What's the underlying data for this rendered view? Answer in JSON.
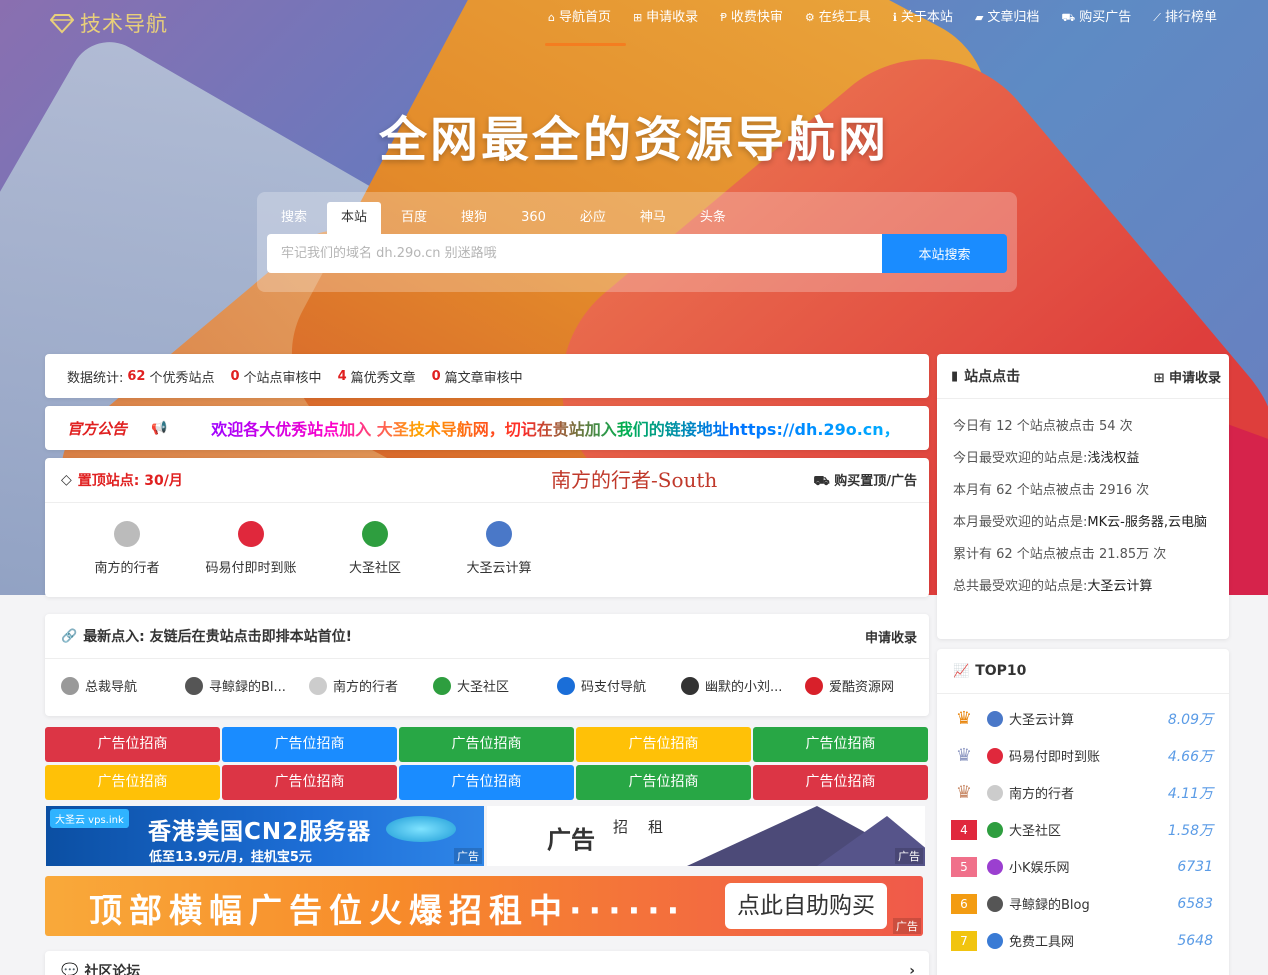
{
  "nav": {
    "logo": "技术导航",
    "items": [
      {
        "label": "导航首页",
        "icon": "home-icon",
        "glyph": "⌂"
      },
      {
        "label": "申请收录",
        "icon": "plus-square-icon",
        "glyph": "⊞"
      },
      {
        "label": "收费快审",
        "icon": "paypal-icon",
        "glyph": "Ᵽ"
      },
      {
        "label": "在线工具",
        "icon": "gears-icon",
        "glyph": "⚙"
      },
      {
        "label": "关于本站",
        "icon": "info-icon",
        "glyph": "ℹ"
      },
      {
        "label": "文章归档",
        "icon": "folder-icon",
        "glyph": "▰"
      },
      {
        "label": "购买广告",
        "icon": "cart-icon",
        "glyph": "⛟"
      },
      {
        "label": "排行榜单",
        "icon": "chart-icon",
        "glyph": "⟋"
      }
    ]
  },
  "hero": {
    "title": "全网最全的资源导航网"
  },
  "search": {
    "tabs": [
      "搜索",
      "本站",
      "百度",
      "搜狗",
      "360",
      "必应",
      "神马",
      "头条"
    ],
    "active_tab": "本站",
    "placeholder": "牢记我们的域名 dh.29o.cn 别迷路哦",
    "button": "本站搜索"
  },
  "stats": {
    "prefix": "数据统计:",
    "sites": "62",
    "sites_label": "个优秀站点",
    "pending_sites": "0",
    "pending_sites_label": "个站点审核中",
    "articles": "4",
    "articles_label": "篇优秀文章",
    "pending_articles": "0",
    "pending_articles_label": "篇文章审核中"
  },
  "notice": {
    "label": "官方公告",
    "text": "欢迎各大优秀站点加入 大圣技术导航网，切记在贵站加入我们的链接地址https://dh.29o.cn，"
  },
  "top_sites": {
    "title": "置顶站点: 30/月",
    "signature": "南方的行者-South",
    "buy": "购买置顶/广告",
    "items": [
      {
        "name": "南方的行者",
        "color": "#bbbbbb"
      },
      {
        "name": "码易付即时到账",
        "color": "#e0283c"
      },
      {
        "name": "大圣社区",
        "color": "#2e9e3f"
      },
      {
        "name": "大圣云计算",
        "color": "#4a78c8"
      }
    ]
  },
  "newest": {
    "title": "最新点入: 友链后在贵站点击即排本站首位!",
    "apply": "申请收录",
    "items": [
      {
        "name": "总裁导航",
        "color": "#999999"
      },
      {
        "name": "寻鲸録的Bl...",
        "color": "#555555"
      },
      {
        "name": "南方的行者",
        "color": "#cccccc"
      },
      {
        "name": "大圣社区",
        "color": "#2e9e3f"
      },
      {
        "name": "码支付导航",
        "color": "#1a6ed8"
      },
      {
        "name": "幽默的小刘...",
        "color": "#333333"
      },
      {
        "name": "爱酷资源网",
        "color": "#d8202a"
      }
    ]
  },
  "ad_slots": {
    "label": "广告位招商",
    "colors": [
      "#dc3545",
      "#1a8cff",
      "#28a745",
      "#ffc107",
      "#28a745",
      "#ffc107",
      "#dc3545",
      "#1a8cff",
      "#28a745",
      "#dc3545"
    ]
  },
  "banners": {
    "b1_logo": "大圣云 vps.ink",
    "b1_title": "香港美国CN2服务器",
    "b1_sub": "低至13.9元/月，挂机宝5元",
    "b2_a": "广告",
    "b2_b": "招租",
    "b3_title": "顶部横幅广告位火爆招租中······",
    "b3_button": "点此自助购买",
    "tag": "广告"
  },
  "forum": {
    "title": "社区论坛"
  },
  "clicks": {
    "title": "站点点击",
    "apply": "申请收录",
    "lines": [
      {
        "text": "今日有 12 个站点被点击 54 次",
        "key": ""
      },
      {
        "text": "今日最受欢迎的站点是:",
        "key": "浅浅权益"
      },
      {
        "text": "本月有 62 个站点被点击 2916 次",
        "key": ""
      },
      {
        "text": "本月最受欢迎的站点是:",
        "key": "MK云-服务器,云电脑"
      },
      {
        "text": "累计有 62 个站点被点击 21.85万 次",
        "key": ""
      },
      {
        "text": "总共最受欢迎的站点是:",
        "key": "大圣云计算"
      }
    ]
  },
  "top10": {
    "title": "TOP10",
    "items": [
      {
        "rank": "",
        "name": "大圣云计算",
        "value": "8.09万",
        "badge": "#e8860f",
        "icon": "#4a78c8"
      },
      {
        "rank": "",
        "name": "码易付即时到账",
        "value": "4.66万",
        "badge": "#8e98c2",
        "icon": "#e0283c"
      },
      {
        "rank": "",
        "name": "南方的行者",
        "value": "4.11万",
        "badge": "#c88a68",
        "icon": "#cccccc"
      },
      {
        "rank": "4",
        "name": "大圣社区",
        "value": "1.58万",
        "badge": "#e0283c",
        "icon": "#2e9e3f"
      },
      {
        "rank": "5",
        "name": "小K娱乐网",
        "value": "6731",
        "badge": "#f0708a",
        "icon": "#9b3fd0"
      },
      {
        "rank": "6",
        "name": "寻鲸録的Blog",
        "value": "6583",
        "badge": "#f39c12",
        "icon": "#555555"
      },
      {
        "rank": "7",
        "name": "免费工具网",
        "value": "5648",
        "badge": "#f1c40f",
        "icon": "#3a7bd5"
      }
    ]
  }
}
